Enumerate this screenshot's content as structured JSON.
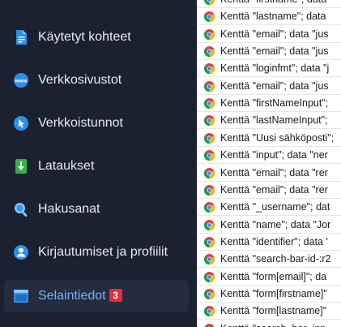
{
  "sidebar": {
    "items": [
      {
        "label": "Käytetyt kohteet"
      },
      {
        "label": "Verkkosivustot"
      },
      {
        "label": "Verkkoistunnot"
      },
      {
        "label": "Lataukset"
      },
      {
        "label": "Hakusanat"
      },
      {
        "label": "Kirjautumiset ja profiilit"
      },
      {
        "label": "Selaintiedot",
        "badge": "3"
      }
    ]
  },
  "list": {
    "rows": [
      "Kenttä \"firstname\"; data",
      "Kenttä \"lastname\"; data",
      "Kenttä \"email\"; data \"jus",
      "Kenttä \"email\"; data \"jus",
      "Kenttä \"loginfmt\"; data \"j",
      "Kenttä \"email\"; data \"jus",
      "Kenttä \"firstNameInput\";",
      "Kenttä \"lastNameInput\";",
      "Kenttä \"Uusi sähköposti\";",
      "Kenttä \"input\"; data \"ner",
      "Kenttä \"email\"; data \"rer",
      "Kenttä \"email\"; data \"rer",
      "Kenttä \"_username\"; dat",
      "Kenttä \"name\"; data \"Jor",
      "Kenttä \"identifier\"; data '",
      "Kenttä \"search-bar-id-:r2",
      "Kenttä \"form[email]\"; da",
      "Kenttä \"form[firstname]\"",
      "Kenttä \"form[lastname]\"",
      "Kenttä \"search_bar_inp"
    ]
  }
}
